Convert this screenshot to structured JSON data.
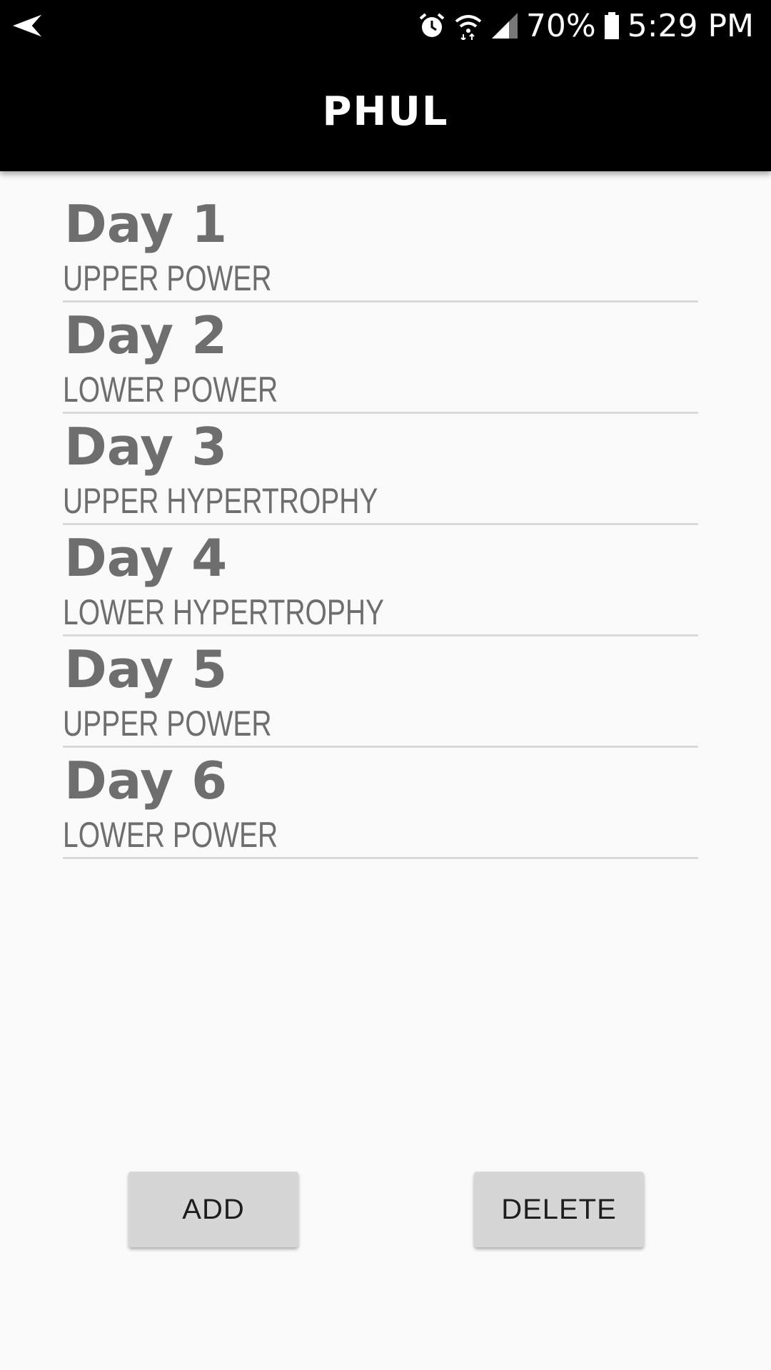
{
  "status_bar": {
    "battery": "70%",
    "time": "5:29 PM",
    "icons": [
      "back-arrow-icon",
      "alarm-icon",
      "wifi-icon",
      "signal-icon",
      "battery-icon"
    ]
  },
  "app_bar": {
    "title": "PHUL"
  },
  "days": [
    {
      "title": "Day 1",
      "subtitle": "UPPER POWER"
    },
    {
      "title": "Day 2",
      "subtitle": "LOWER POWER"
    },
    {
      "title": "Day 3",
      "subtitle": "UPPER HYPERTROPHY"
    },
    {
      "title": "Day 4",
      "subtitle": "LOWER HYPERTROPHY"
    },
    {
      "title": "Day 5",
      "subtitle": "UPPER POWER"
    },
    {
      "title": "Day 6",
      "subtitle": "LOWER POWER"
    }
  ],
  "buttons": {
    "add_label": "ADD",
    "delete_label": "DELETE"
  },
  "colors": {
    "app_bar": "#000000",
    "background": "#fafafa",
    "text": "#6e6e6e",
    "divider": "#d9d9d9",
    "button": "#d6d6d6"
  }
}
